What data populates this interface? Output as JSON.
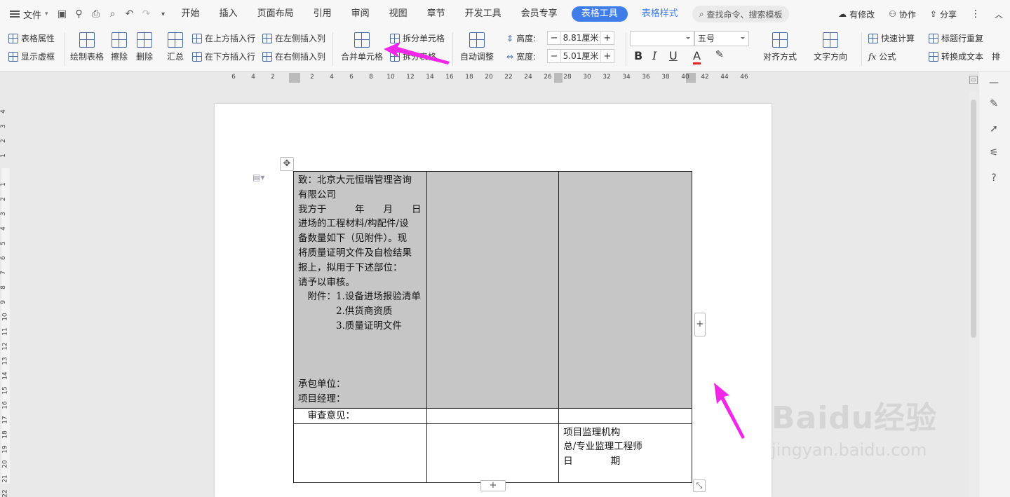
{
  "menubar": {
    "file_label": "文件",
    "tabs": [
      "开始",
      "插入",
      "页面布局",
      "引用",
      "审阅",
      "视图",
      "章节",
      "开发工具",
      "会员专享"
    ],
    "active_tab": "表格工具",
    "style_tab": "表格样式",
    "search_placeholder": "查找命令、搜索模板",
    "modified_label": "有修改",
    "collab_label": "协作",
    "share_label": "分享"
  },
  "ribbon": {
    "table_props": "表格属性",
    "show_grid": "显示虚框",
    "draw_table": "绘制表格",
    "erase": "擦除",
    "delete": "删除",
    "summary": "汇总",
    "insert_above": "在上方插入行",
    "insert_below": "在下方插入行",
    "insert_left": "在左侧插入列",
    "insert_right": "在右侧插入列",
    "merge_cells": "合并单元格",
    "split_cells": "拆分单元格",
    "split_table": "拆分表格",
    "auto_adjust": "自动调整",
    "height_label": "高度:",
    "height_value": "8.81厘米",
    "width_label": "宽度:",
    "width_value": "5.01厘米",
    "font_name": "",
    "font_size": "五号",
    "align": "对齐方式",
    "text_dir": "文字方向",
    "quick_calc": "快速计算",
    "formula": "公式",
    "repeat_header": "标题行重复",
    "to_text": "转换成文本",
    "sort": "排"
  },
  "ruler_top": [
    "6",
    "4",
    "2",
    "2",
    "4",
    "6",
    "8",
    "10",
    "12",
    "14",
    "16",
    "18",
    "20",
    "22",
    "24",
    "26",
    "28",
    "30",
    "32",
    "34",
    "36",
    "38",
    "40",
    "42",
    "44",
    "46"
  ],
  "ruler_left": [
    "4",
    "3",
    "2",
    "1",
    "1",
    "2",
    "3",
    "4",
    "5",
    "6",
    "7",
    "8",
    "9",
    "10",
    "11",
    "12",
    "13",
    "14",
    "15",
    "16",
    "17",
    "18",
    "19",
    "20",
    "21",
    "22"
  ],
  "table": {
    "cell1_lines": [
      "致：北京大元恒瑞管理咨询",
      "有限公司",
      "我方于　　　年　　月　　日",
      "进场的工程材料/构配件/设",
      "备数量如下（见附件）。现",
      "将质量证明文件及自检结果",
      "报上，拟用于下述部位：",
      "请予以审核。",
      "　附件：1.设备进场报验清单",
      "　　　　2.供货商资质",
      "　　　　3.质量证明文件",
      "",
      "",
      "",
      "承包单位：",
      "项目经理："
    ],
    "review_label": "　审查意见：",
    "supervision_lines": [
      "项目监理机构",
      "总/专业监理工程师",
      "日　　　　期"
    ]
  },
  "watermark": {
    "brand": "Baidu经验",
    "url": "jingyan.baidu.com"
  }
}
